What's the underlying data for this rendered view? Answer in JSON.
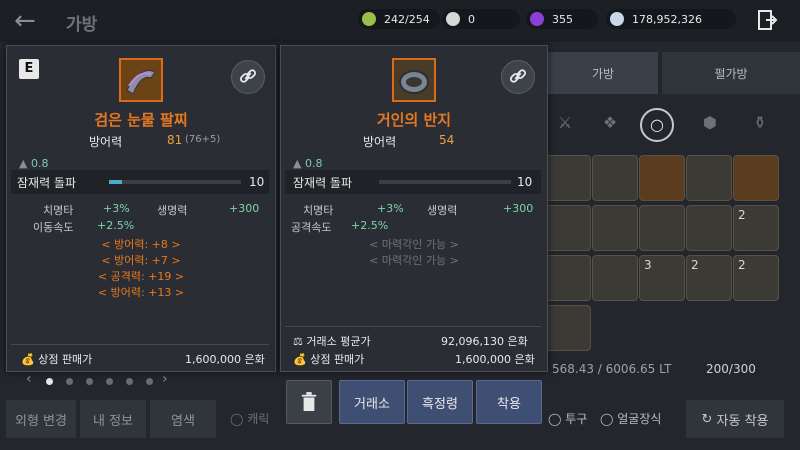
{
  "header": {
    "back_label": "←",
    "title": "가방",
    "currencies": [
      {
        "icon": "stamina-icon",
        "value": "242/254",
        "color": "#9bbf4a"
      },
      {
        "icon": "pearl-icon",
        "value": "0",
        "color": "#d8d8d8"
      },
      {
        "icon": "gem-icon",
        "value": "355",
        "color": "#8b3fd6"
      },
      {
        "icon": "silver-icon",
        "value": "178,952,326",
        "color": "#c8d8e8"
      }
    ]
  },
  "background": {
    "tabs": [
      {
        "label": "가방"
      },
      {
        "label": "펄가방"
      }
    ],
    "weight": "568.43 / 6006.65 LT",
    "slots": "200/300",
    "slot_counts": [
      "2",
      "3",
      "2",
      "2",
      "2"
    ],
    "bottom_buttons": [
      {
        "label": "외형 변경"
      },
      {
        "label": "내 정보"
      },
      {
        "label": "염색"
      }
    ],
    "toggles": [
      {
        "label": "캐릭"
      },
      {
        "label": "투구"
      },
      {
        "label": "얼굴장식"
      }
    ],
    "auto_equip_label": "자동 착용"
  },
  "card_left": {
    "badge": "E",
    "name": "검은 눈물 팔찌",
    "stat_label": "방어력",
    "stat_value": "81",
    "stat_extra": "(76+5)",
    "weight": "0.8",
    "limit_label": "잠재력 돌파",
    "limit_value": "10",
    "limit_fill": 0.1,
    "subs": [
      {
        "label": "치명타",
        "value": "+3%"
      },
      {
        "label": "생명력",
        "value": "+300"
      },
      {
        "label": "이동속도",
        "value": "+2.5%"
      }
    ],
    "bonus_lines": [
      "< 방어력: +8 >",
      "< 방어력: +7 >",
      "< 공격력: +19 >",
      "< 방어력: +13 >"
    ],
    "sell_label": "상점 판매가",
    "sell_value": "1,600,000 은화"
  },
  "card_right": {
    "name": "거인의 반지",
    "stat_label": "방어력",
    "stat_value": "54",
    "weight": "0.8",
    "limit_label": "잠재력 돌파",
    "limit_value": "10",
    "limit_fill": 0.0,
    "subs": [
      {
        "label": "치명타",
        "value": "+3%"
      },
      {
        "label": "생명력",
        "value": "+300"
      },
      {
        "label": "공격속도",
        "value": "+2.5%"
      }
    ],
    "grey_lines": [
      "< 마력각인 가능 >",
      "< 마력각인 가능 >"
    ],
    "market_label": "거래소 평균가",
    "market_value": "92,096,130 은화",
    "sell_label": "상점 판매가",
    "sell_value": "1,600,000 은화"
  },
  "actions": {
    "trade": "거래소",
    "refine": "흑정령",
    "equip": "착용"
  },
  "pager": {
    "left": "‹",
    "right": "›"
  }
}
